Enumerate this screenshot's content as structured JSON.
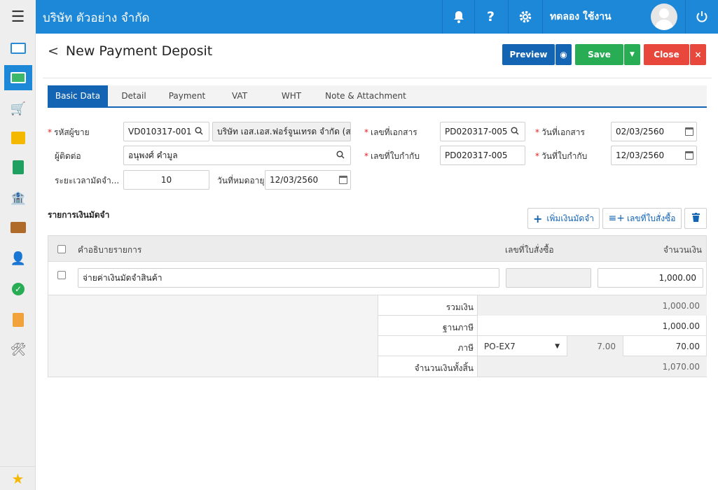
{
  "topbar": {
    "company": "บริษัท ตัวอย่าง จำกัด",
    "username": "ทดลอง ใช้งาน"
  },
  "header": {
    "title": "New Payment Deposit",
    "preview_label": "Preview",
    "save_label": "Save",
    "close_label": "Close"
  },
  "tabs": [
    "Basic Data",
    "Detail",
    "Payment",
    "VAT",
    "WHT",
    "Note & Attachment"
  ],
  "form": {
    "vendor_code_label": "รหัสผู้ขาย",
    "vendor_code": "VD010317-001",
    "vendor_name": "บริษัท เอส.เอส.ฟอร์จูนเทรด จำกัด (ส",
    "contact_label": "ผู้ติดต่อ",
    "contact": "อนุพงศ์ คำมูล",
    "deposit_period_label": "ระยะเวลามัดจำ...",
    "deposit_period": "10",
    "expiry_label": "วันที่หมดอายุ",
    "expiry_date": "12/03/2560",
    "doc_no_label": "เลขที่เอกสาร",
    "doc_no": "PD020317-005",
    "tax_invoice_no_label": "เลขที่ใบกำกับ",
    "tax_invoice_no": "PD020317-005",
    "doc_date_label": "วันที่เอกสาร",
    "doc_date": "02/03/2560",
    "tax_invoice_date_label": "วันที่ใบกำกับ",
    "tax_invoice_date": "12/03/2560"
  },
  "section": {
    "title": "รายการเงินมัดจำ",
    "add_deposit_label": "เพิ่มเงินมัดจำ",
    "po_no_button_label": "เลขที่ใบสั่งซื้อ"
  },
  "grid": {
    "headers": {
      "description": "คำอธิบายรายการ",
      "po_no": "เลขที่ใบสั่งซื้อ",
      "amount": "จำนวนเงิน"
    },
    "rows": [
      {
        "description": "จ่ายค่าเงินมัดจำสินค้า",
        "po_no": "",
        "amount": "1,000.00"
      }
    ]
  },
  "summary": {
    "total_label": "รวมเงิน",
    "total": "1,000.00",
    "tax_base_label": "ฐานภาษี",
    "tax_base": "1,000.00",
    "tax_label": "ภาษี",
    "tax_code": "PO-EX7",
    "tax_rate": "7.00",
    "tax_amount": "70.00",
    "grand_total_label": "จำนวนเงินทั้งสิ้น",
    "grand_total": "1,070.00"
  }
}
